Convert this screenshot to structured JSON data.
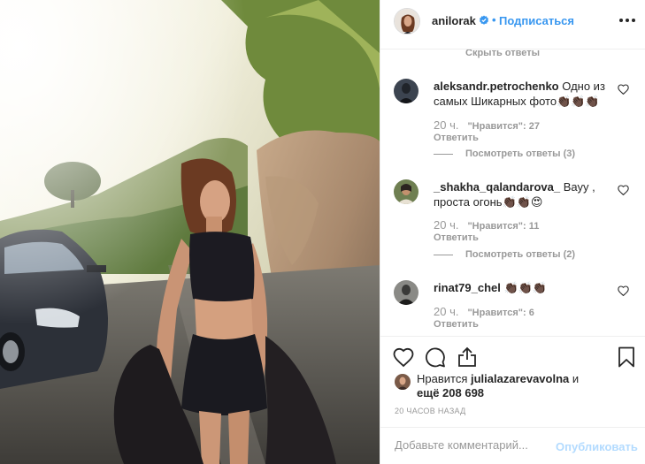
{
  "header": {
    "username": "anilorak",
    "separator": "•",
    "follow_label": "Подписаться",
    "verified_icon": "verified-badge-icon",
    "more_icon": "more-options-icon"
  },
  "comments": {
    "hide_replies": "Скрыть ответы",
    "items": [
      {
        "username": "aleksandr.petrochenko",
        "text": "Одно из самых Шикарных фото👏🏿👏🏿👏🏿",
        "time": "20 ч.",
        "likes": "\"Нравится\": 27",
        "reply": "Ответить",
        "view_replies": "Посмотреть ответы (3)"
      },
      {
        "username": "_shakha_qalandarova_",
        "text": "Вауу , проста огонь👏🏿👏🏿😍",
        "time": "20 ч.",
        "likes": "\"Нравится\": 11",
        "reply": "Ответить",
        "view_replies": "Посмотреть ответы (2)"
      },
      {
        "username": "rinat79_chel",
        "text": "👏🏿👏🏿👏🏿",
        "time": "20 ч.",
        "likes": "\"Нравится\": 6",
        "reply": "Ответить"
      }
    ]
  },
  "actions": {
    "like_icon": "heart-icon",
    "comment_icon": "comment-icon",
    "share_icon": "share-icon",
    "save_icon": "bookmark-icon"
  },
  "likes_summary": {
    "prefix": "Нравится ",
    "user": "julialazarevavolna",
    "suffix": " и",
    "more": "ещё 208 698"
  },
  "time_ago": "20 ЧАСОВ НАЗАД",
  "add_comment": {
    "placeholder": "Добавьте комментарий...",
    "publish_label": "Опубликовать"
  },
  "colors": {
    "accent": "#3897f0",
    "muted": "#999999",
    "publish_disabled": "#b3dbff",
    "border": "#efefef"
  }
}
